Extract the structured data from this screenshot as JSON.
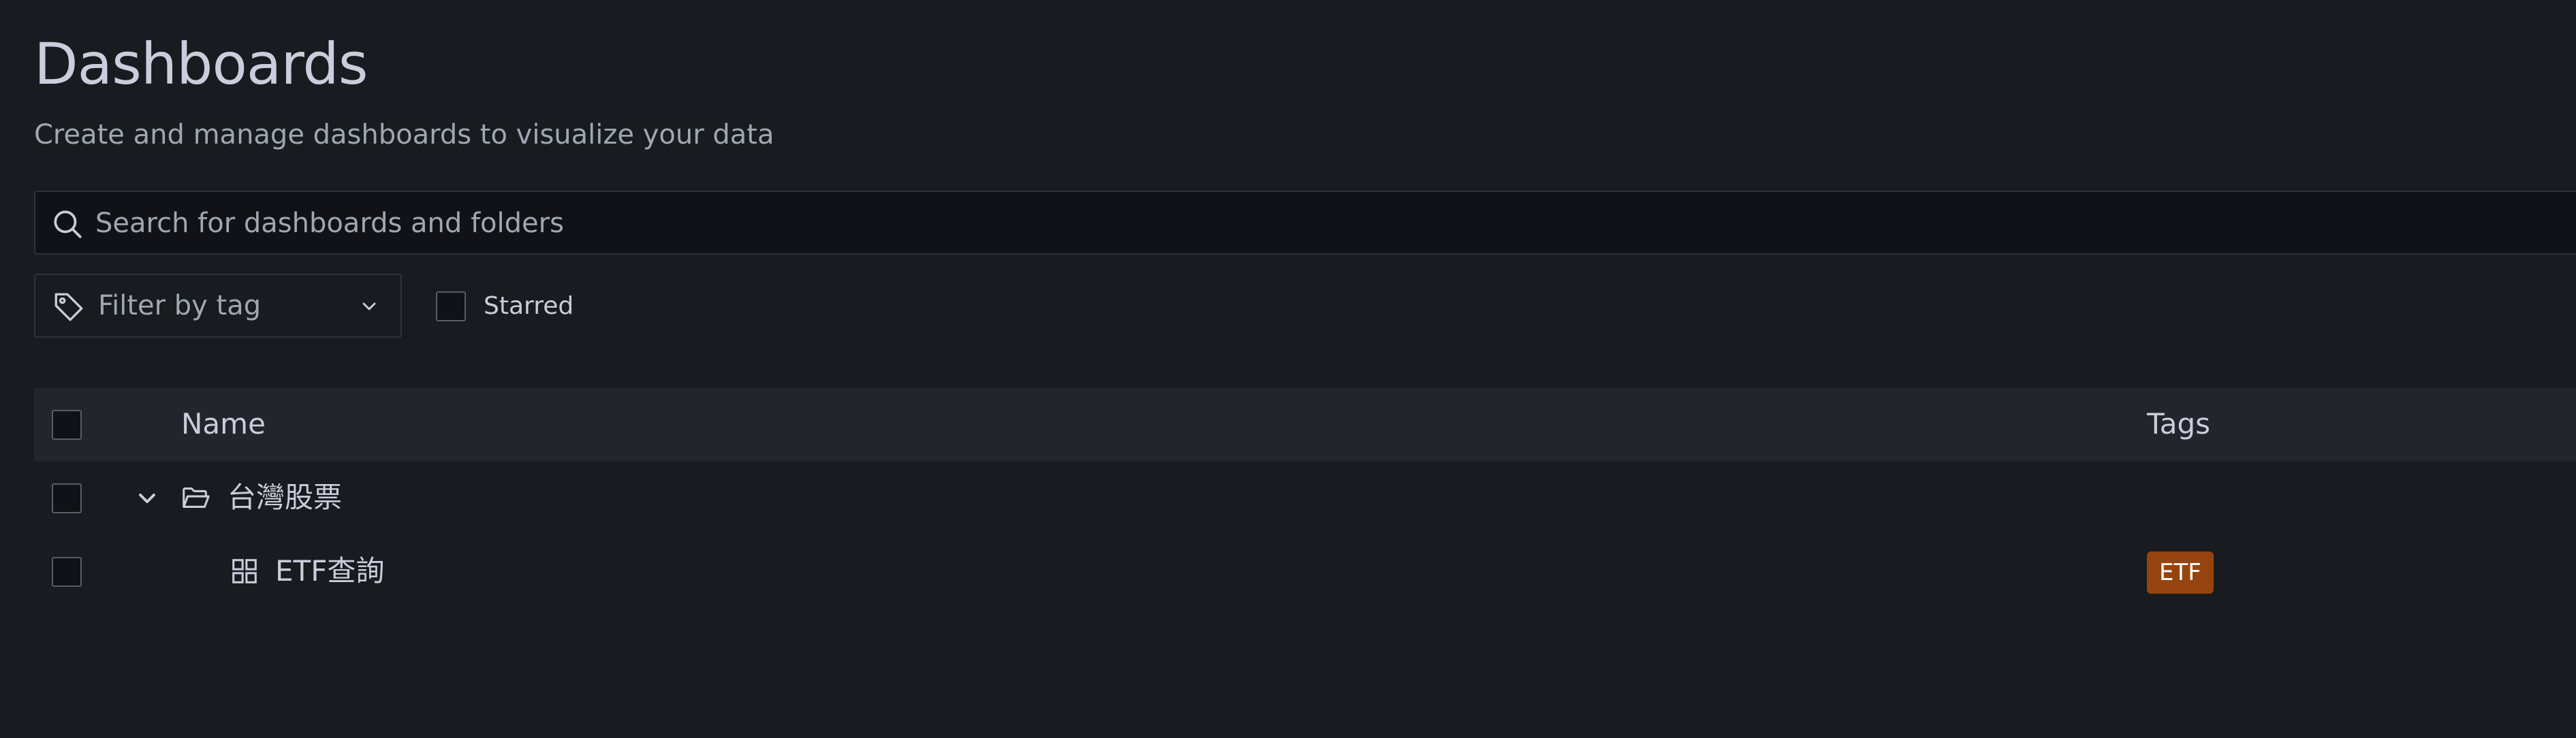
{
  "header": {
    "title": "Dashboards",
    "subtitle": "Create and manage dashboards to visualize your data"
  },
  "search": {
    "placeholder": "Search for dashboards and folders",
    "value": "",
    "icon": "search-icon"
  },
  "filters": {
    "tag_placeholder": "Filter by tag",
    "tag_icon": "tag-icon",
    "starred_label": "Starred",
    "starred_checked": false
  },
  "table": {
    "columns": [
      "Name",
      "Tags"
    ],
    "rows": [
      {
        "type": "folder",
        "name": "台灣股票",
        "expanded": true,
        "icon": "folder-open-icon",
        "tags": []
      },
      {
        "type": "dashboard",
        "name": "ETF查詢",
        "icon": "apps-icon",
        "tags": [
          "ETF"
        ]
      }
    ]
  },
  "colors": {
    "background": "#181b1f",
    "header_row": "#22252b",
    "tag_etf": "#96440f"
  }
}
